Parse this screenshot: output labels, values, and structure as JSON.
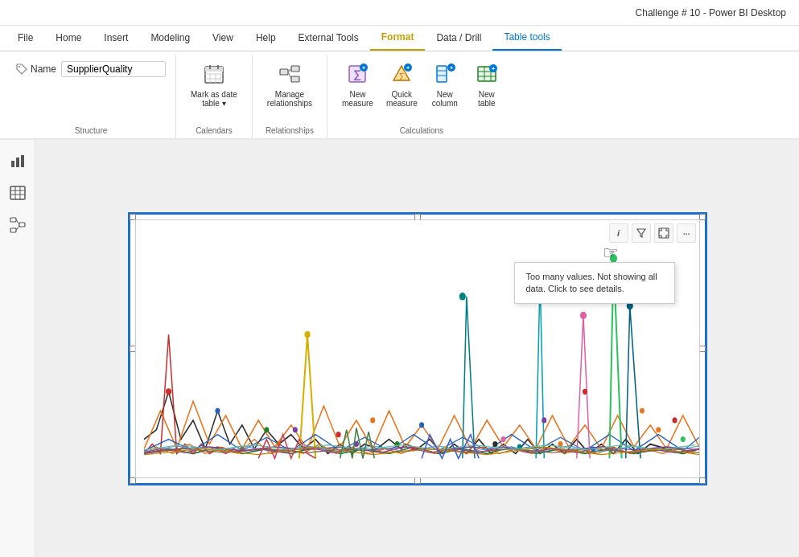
{
  "titlebar": {
    "title": "Challenge # 10 - Power BI Desktop"
  },
  "menutabs": {
    "tabs": [
      {
        "label": "File",
        "state": "normal"
      },
      {
        "label": "Home",
        "state": "normal"
      },
      {
        "label": "Insert",
        "state": "normal"
      },
      {
        "label": "Modeling",
        "state": "normal"
      },
      {
        "label": "View",
        "state": "normal"
      },
      {
        "label": "Help",
        "state": "normal"
      },
      {
        "label": "External Tools",
        "state": "normal"
      },
      {
        "label": "Format",
        "state": "active-yellow"
      },
      {
        "label": "Data / Drill",
        "state": "normal"
      },
      {
        "label": "Table tools",
        "state": "active-blue"
      }
    ]
  },
  "ribbon": {
    "structure": {
      "name_label": "Name",
      "name_value": "SupplierQuality",
      "section_label": "Structure"
    },
    "calendars": {
      "mark_as_date_label": "Mark as date",
      "mark_as_date_sub": "table ▾",
      "section_label": "Calendars"
    },
    "relationships": {
      "manage_label": "Manage",
      "manage_sub": "relationships",
      "section_label": "Relationships"
    },
    "calculations": {
      "new_measure_label": "New",
      "new_measure_sub": "measure",
      "quick_measure_label": "Quick",
      "quick_measure_sub": "measure",
      "new_column_label": "New",
      "new_column_sub": "column",
      "new_table_label": "New",
      "new_table_sub": "table",
      "section_label": "Calculations"
    }
  },
  "sidebar": {
    "icons": [
      {
        "name": "bar-chart-icon",
        "label": "Bar chart view"
      },
      {
        "name": "table-icon",
        "label": "Table view"
      },
      {
        "name": "model-icon",
        "label": "Model view"
      }
    ]
  },
  "chart": {
    "warning_text": "Too many values. Not showing all data. Click to see details."
  },
  "tooltip_icons": [
    {
      "name": "info-icon",
      "symbol": "i"
    },
    {
      "name": "filter-icon",
      "symbol": "⊤"
    },
    {
      "name": "focus-icon",
      "symbol": "⊡"
    },
    {
      "name": "more-icon",
      "symbol": "..."
    }
  ]
}
